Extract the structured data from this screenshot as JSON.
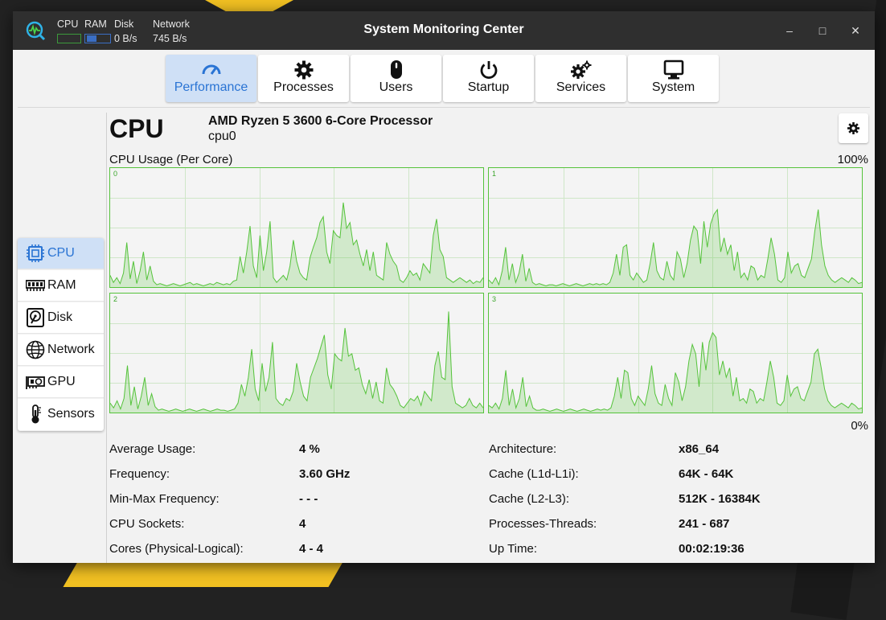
{
  "window": {
    "title": "System Monitoring Center",
    "minimize": "–",
    "maximize": "□",
    "close": "✕"
  },
  "mini": {
    "cpu_label": "CPU",
    "ram_label": "RAM",
    "disk_label": "Disk",
    "disk_value": "0 B/s",
    "network_label": "Network",
    "network_value": "745 B/s"
  },
  "tabs": [
    {
      "label": "Performance",
      "icon": "gauge-icon"
    },
    {
      "label": "Processes",
      "icon": "gear-icon"
    },
    {
      "label": "Users",
      "icon": "mouse-icon"
    },
    {
      "label": "Startup",
      "icon": "power-icon"
    },
    {
      "label": "Services",
      "icon": "gears-icon"
    },
    {
      "label": "System",
      "icon": "monitor-icon"
    }
  ],
  "sidebar": [
    {
      "label": "CPU",
      "icon": "chip-icon"
    },
    {
      "label": "RAM",
      "icon": "memory-icon"
    },
    {
      "label": "Disk",
      "icon": "disk-icon"
    },
    {
      "label": "Network",
      "icon": "globe-icon"
    },
    {
      "label": "GPU",
      "icon": "gpu-icon"
    },
    {
      "label": "Sensors",
      "icon": "thermometer-icon"
    }
  ],
  "cpu": {
    "title": "CPU",
    "model": "AMD Ryzen 5 3600 6-Core Processor",
    "device": "cpu0",
    "usage_label": "CPU Usage (Per Core)",
    "max_label": "100%",
    "min_label": "0%"
  },
  "chart_data": {
    "type": "area",
    "ylim": [
      0,
      100
    ],
    "color": "#55c33b",
    "series": [
      {
        "name": "0",
        "values": [
          10,
          4,
          8,
          3,
          12,
          38,
          7,
          22,
          3,
          14,
          30,
          6,
          18,
          5,
          2,
          3,
          2,
          1,
          2,
          3,
          2,
          1,
          2,
          3,
          4,
          2,
          3,
          2,
          1,
          2,
          3,
          2,
          4,
          3,
          2,
          3,
          2,
          5,
          6,
          26,
          12,
          30,
          52,
          18,
          8,
          44,
          14,
          30,
          56,
          8,
          4,
          7,
          10,
          6,
          18,
          40,
          22,
          12,
          8,
          6,
          25,
          34,
          42,
          55,
          60,
          30,
          20,
          48,
          44,
          42,
          72,
          50,
          55,
          36,
          40,
          28,
          18,
          32,
          14,
          30,
          10,
          8,
          6,
          38,
          28,
          22,
          18,
          6,
          4,
          8,
          14,
          10,
          12,
          6,
          20,
          16,
          12,
          44,
          58,
          32,
          26,
          8,
          6,
          4,
          6,
          8,
          6,
          4,
          6,
          3,
          5,
          4,
          8
        ]
      },
      {
        "name": "1",
        "values": [
          6,
          3,
          8,
          2,
          14,
          34,
          6,
          20,
          4,
          12,
          28,
          5,
          16,
          4,
          2,
          3,
          2,
          1,
          2,
          2,
          1,
          2,
          3,
          2,
          1,
          2,
          3,
          2,
          1,
          2,
          3,
          2,
          3,
          2,
          3,
          2,
          4,
          12,
          28,
          10,
          34,
          36,
          10,
          6,
          12,
          8,
          4,
          6,
          20,
          38,
          14,
          8,
          6,
          22,
          10,
          6,
          30,
          24,
          8,
          20,
          40,
          52,
          48,
          20,
          56,
          34,
          54,
          62,
          66,
          30,
          42,
          28,
          36,
          14,
          30,
          8,
          12,
          6,
          18,
          16,
          6,
          10,
          8,
          24,
          42,
          28,
          6,
          4,
          8,
          30,
          12,
          18,
          20,
          10,
          8,
          16,
          24,
          48,
          66,
          36,
          18,
          10,
          6,
          4,
          6,
          8,
          6,
          4,
          8,
          6,
          3,
          4
        ]
      },
      {
        "name": "2",
        "values": [
          8,
          4,
          10,
          3,
          12,
          40,
          6,
          22,
          3,
          14,
          30,
          6,
          16,
          5,
          2,
          3,
          2,
          1,
          2,
          3,
          2,
          1,
          2,
          3,
          2,
          1,
          2,
          3,
          2,
          1,
          2,
          3,
          2,
          2,
          1,
          2,
          3,
          8,
          24,
          14,
          30,
          54,
          20,
          10,
          42,
          18,
          30,
          60,
          12,
          8,
          6,
          12,
          10,
          18,
          42,
          26,
          14,
          10,
          30,
          38,
          46,
          56,
          66,
          32,
          20,
          50,
          46,
          44,
          72,
          48,
          50,
          36,
          38,
          24,
          16,
          28,
          12,
          26,
          10,
          8,
          38,
          24,
          20,
          14,
          6,
          4,
          8,
          12,
          10,
          14,
          6,
          18,
          14,
          10,
          40,
          52,
          30,
          28,
          86,
          22,
          8,
          6,
          4,
          6,
          12,
          6,
          4,
          8,
          4
        ]
      },
      {
        "name": "3",
        "values": [
          6,
          4,
          8,
          3,
          12,
          36,
          6,
          20,
          4,
          12,
          30,
          5,
          14,
          4,
          2,
          2,
          3,
          2,
          1,
          2,
          3,
          2,
          1,
          2,
          3,
          2,
          1,
          2,
          3,
          2,
          1,
          2,
          3,
          2,
          3,
          2,
          4,
          14,
          30,
          12,
          36,
          34,
          12,
          6,
          14,
          10,
          6,
          20,
          40,
          16,
          8,
          6,
          24,
          12,
          6,
          34,
          26,
          10,
          22,
          44,
          58,
          50,
          22,
          60,
          36,
          60,
          68,
          64,
          32,
          44,
          30,
          38,
          14,
          30,
          10,
          12,
          8,
          20,
          18,
          8,
          12,
          10,
          26,
          44,
          30,
          8,
          6,
          10,
          32,
          14,
          20,
          22,
          12,
          10,
          18,
          26,
          50,
          54,
          38,
          20,
          10,
          6,
          4,
          6,
          8,
          6,
          4,
          8,
          6,
          3,
          4
        ]
      }
    ]
  },
  "stats_left": [
    {
      "label": "Average Usage:",
      "value": "4 %"
    },
    {
      "label": "Frequency:",
      "value": "3.60 GHz"
    },
    {
      "label": "Min-Max Frequency:",
      "value": "- - -"
    },
    {
      "label": "CPU Sockets:",
      "value": "4"
    },
    {
      "label": "Cores (Physical-Logical):",
      "value": "4 - 4"
    }
  ],
  "stats_right": [
    {
      "label": "Architecture:",
      "value": "x86_64"
    },
    {
      "label": "Cache (L1d-L1i):",
      "value": "64K - 64K"
    },
    {
      "label": "Cache (L2-L3):",
      "value": "512K - 16384K"
    },
    {
      "label": "Processes-Threads:",
      "value": "241 - 687"
    },
    {
      "label": "Up Time:",
      "value": "00:02:19:36"
    }
  ]
}
